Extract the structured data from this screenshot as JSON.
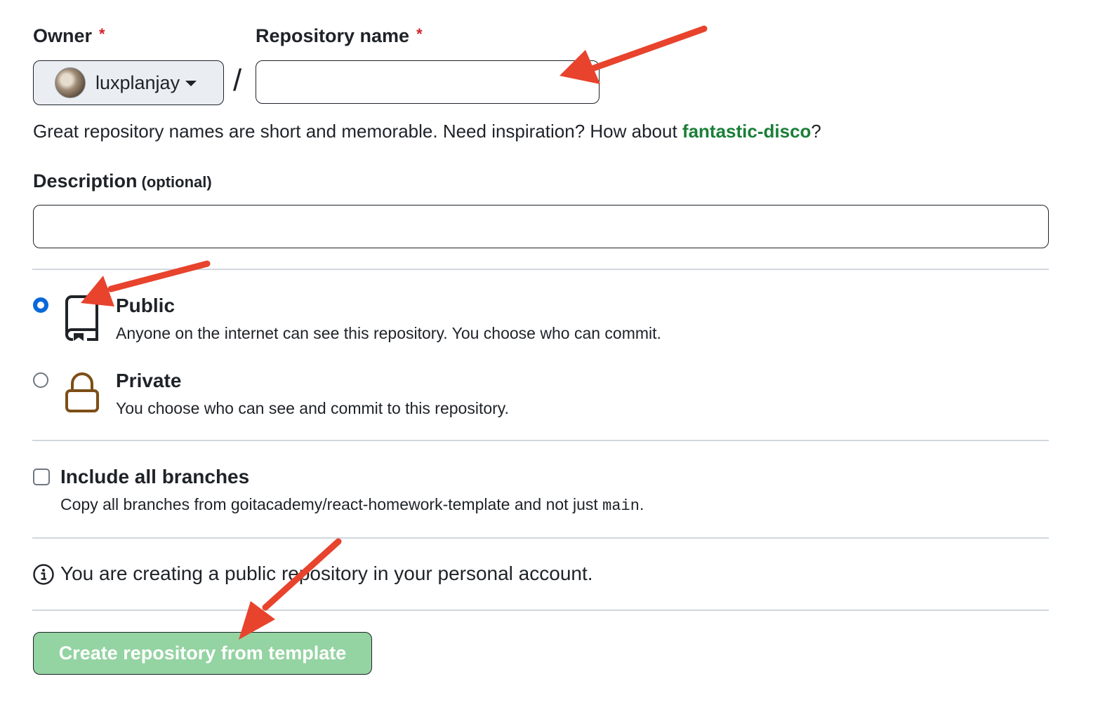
{
  "owner": {
    "label": "Owner",
    "required_mark": "*",
    "selected": "luxplanjay"
  },
  "separator": "/",
  "repo_name": {
    "label": "Repository name",
    "required_mark": "*",
    "value": ""
  },
  "hint": {
    "text": "Great repository names are short and memorable. Need inspiration? How about ",
    "suggestion": "fantastic-disco",
    "suffix": "?"
  },
  "description": {
    "label": "Description",
    "optional": "(optional)",
    "value": ""
  },
  "visibility": {
    "selected": "public",
    "public": {
      "title": "Public",
      "desc": "Anyone on the internet can see this repository. You choose who can commit.",
      "icon": "repo-icon"
    },
    "private": {
      "title": "Private",
      "desc": "You choose who can see and commit to this repository.",
      "icon": "lock-icon"
    }
  },
  "branches": {
    "checked": false,
    "title": "Include all branches",
    "desc_prefix": "Copy all branches from goitacademy/react-homework-template and not just ",
    "desc_code": "main",
    "desc_suffix": "."
  },
  "notice": {
    "icon": "info-icon",
    "text": "You are creating a public repository in your personal account."
  },
  "submit": {
    "label": "Create repository from template",
    "disabled": true
  },
  "colors": {
    "accent_blue": "#0969da",
    "success_green": "#1a7f37",
    "button_disabled_bg": "#94d3a2",
    "required_red": "#cf222e",
    "annotation_arrow": "#e8432d",
    "lock_brown": "#7d4e17"
  }
}
